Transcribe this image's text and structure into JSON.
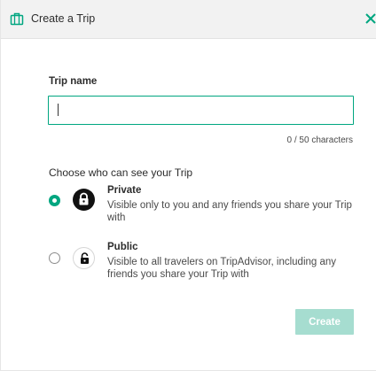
{
  "header": {
    "title": "Create a Trip",
    "icon": "suitcase-icon",
    "close_icon": "close-icon"
  },
  "trip_name": {
    "label": "Trip name",
    "value": "",
    "char_count": "0 / 50 characters"
  },
  "visibility": {
    "title": "Choose who can see your Trip",
    "options": [
      {
        "title": "Private",
        "description": "Visible only to you and any friends you share your Trip with",
        "selected": true,
        "icon": "lock-icon"
      },
      {
        "title": "Public",
        "description": "Visible to all travelers on TripAdvisor, including any friends you share your Trip with",
        "selected": false,
        "icon": "unlock-icon"
      }
    ]
  },
  "actions": {
    "create_label": "Create"
  },
  "colors": {
    "accent": "#00a680",
    "accent_disabled": "#a6ddd0",
    "header_bg": "#f2f2f2"
  }
}
